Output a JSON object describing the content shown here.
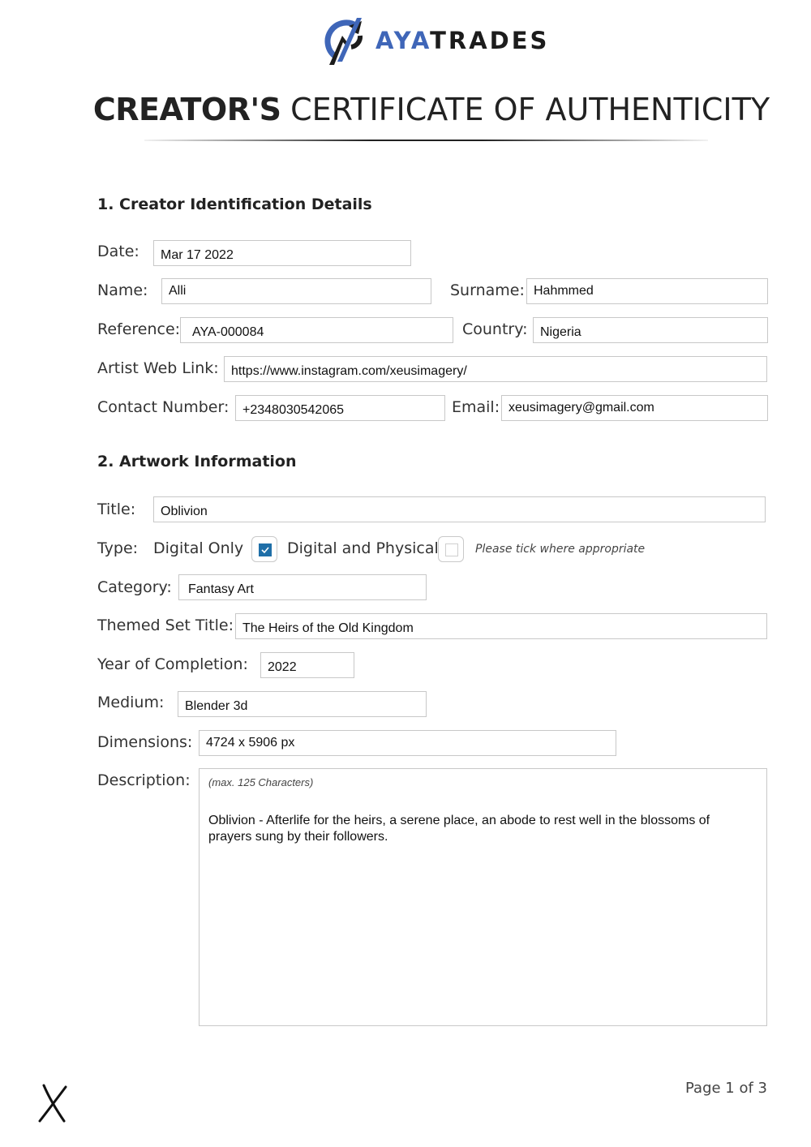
{
  "brand": {
    "logo_icon": "ayatrades-logo-mark",
    "name_part1": "AYA",
    "name_part2": "TRADES",
    "colors": {
      "blue": "#3f66b8",
      "dark": "#1c1c1c"
    }
  },
  "document": {
    "title_bold": "CREATOR'S",
    "title_light": "CERTIFICATE OF AUTHENTICITY"
  },
  "section1": {
    "heading": "1. Creator Identification Details",
    "fields": {
      "date": {
        "label": "Date:",
        "value": "Mar 17 2022"
      },
      "name": {
        "label": "Name:",
        "value": "Alli"
      },
      "surname": {
        "label": "Surname:",
        "value": "Hahmmed"
      },
      "reference": {
        "label": "Reference:",
        "value": "AYA-000084"
      },
      "country": {
        "label": "Country:",
        "value": "Nigeria"
      },
      "web_link": {
        "label": "Artist Web Link:",
        "value": "https://www.instagram.com/xeusimagery/"
      },
      "contact": {
        "label": "Contact Number:",
        "value": "+2348030542065"
      },
      "email": {
        "label": "Email:",
        "value": "xeusimagery@gmail.com"
      }
    }
  },
  "section2": {
    "heading": "2. Artwork Information",
    "fields": {
      "title": {
        "label": "Title:",
        "value": "Oblivion"
      },
      "type": {
        "label": "Type:",
        "options": [
          {
            "label": "Digital Only",
            "checked": true
          },
          {
            "label": "Digital and Physical",
            "checked": false
          }
        ],
        "hint": "Please tick where appropriate"
      },
      "category": {
        "label": "Category:",
        "value": "Fantasy Art"
      },
      "themed_set": {
        "label": "Themed Set Title:",
        "value": "The Heirs of the Old Kingdom"
      },
      "year": {
        "label": "Year of Completion:",
        "value": "2022"
      },
      "medium": {
        "label": "Medium:",
        "value": "Blender 3d"
      },
      "dimensions": {
        "label": "Dimensions:",
        "value": "4724 x 5906 px"
      },
      "description": {
        "label": "Description:",
        "hint": "(max. 125 Characters)",
        "value": "Oblivion - Afterlife for the heirs, a serene place, an abode to rest well in the blossoms of prayers sung by their followers."
      }
    }
  },
  "footer": {
    "signature_mark": "X",
    "page_label": "Page 1 of 3"
  }
}
